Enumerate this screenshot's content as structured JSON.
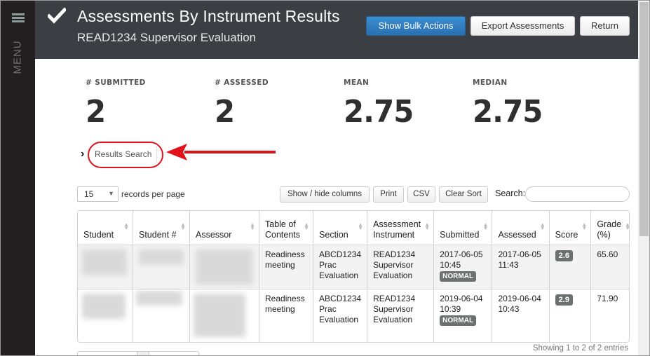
{
  "sidebar": {
    "menu_label": "MENU",
    "menu_icon": "hamburger-icon"
  },
  "header": {
    "title": "Assessments By Instrument Results",
    "subtitle": "READ1234 Supervisor Evaluation",
    "icon": "checkmark-icon",
    "buttons": {
      "bulk_actions": "Show Bulk Actions",
      "export": "Export Assessments",
      "return": "Return"
    }
  },
  "stats": [
    {
      "label": "# SUBMITTED",
      "value": "2"
    },
    {
      "label": "# ASSESSED",
      "value": "2"
    },
    {
      "label": "MEAN",
      "value": "2.75"
    },
    {
      "label": "MEDIAN",
      "value": "2.75"
    }
  ],
  "results_search": {
    "label": "Results Search",
    "chevron": "›"
  },
  "toolbar": {
    "page_size": "15",
    "records_label": "records per page",
    "show_hide_columns": "Show / hide columns",
    "print": "Print",
    "csv": "CSV",
    "clear_sort": "Clear Sort",
    "search_label": "Search:",
    "search_value": ""
  },
  "table": {
    "columns": [
      "Student",
      "Student #",
      "Assessor",
      "Table of Contents",
      "Section",
      "Assessment Instrument",
      "Submitted",
      "Assessed",
      "Score",
      "Grade (%)"
    ],
    "rows": [
      {
        "student": "",
        "student_number": "",
        "assessor": "",
        "toc": "Readiness meeting",
        "section": "ABCD1234 Prac Evaluation",
        "instrument": "READ1234 Supervisor Evaluation",
        "submitted": "2017-06-05 10:45",
        "submitted_badge": "NORMAL",
        "assessed": "2017-06-05 11:43",
        "score": "2.6",
        "grade": "65.60"
      },
      {
        "student": "",
        "student_number": "",
        "assessor": "",
        "toc": "Readiness meeting",
        "section": "ABCD1234 Prac Evaluation",
        "instrument": "READ1234 Supervisor Evaluation",
        "submitted": "2019-06-04 10:39",
        "submitted_badge": "NORMAL",
        "assessed": "2019-06-04 10:43",
        "score": "2.9",
        "grade": "71.90"
      }
    ]
  },
  "footer": {
    "showing": "Showing 1 to 2 of 2 entries"
  },
  "colors": {
    "header_bg": "#3b3e43",
    "sidebar_bg": "#231f20",
    "primary": "#2a7cc3",
    "annotation": "#e0131b",
    "badge": "#6b716f"
  }
}
